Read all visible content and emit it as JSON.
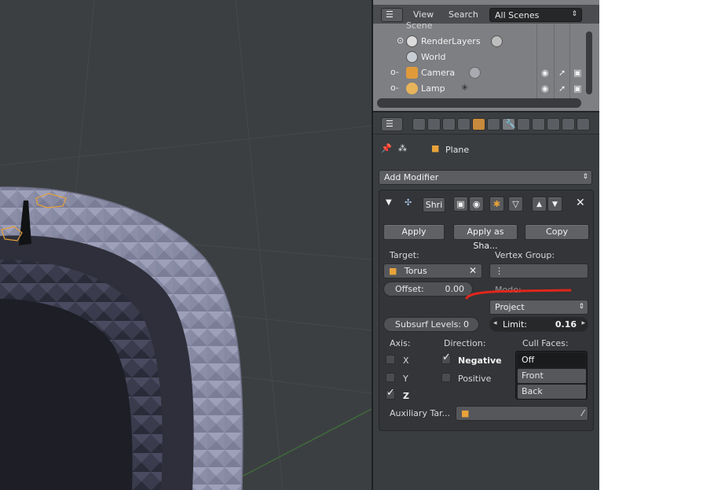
{
  "outliner": {
    "menu_view": "View",
    "menu_search": "Search",
    "scene_select": "All Scenes",
    "items": [
      {
        "label": "Scene"
      },
      {
        "label": "RenderLayers"
      },
      {
        "label": "World"
      },
      {
        "label": "Camera"
      },
      {
        "label": "Lamp"
      }
    ]
  },
  "properties": {
    "context_object": "Plane",
    "add_modifier": "Add Modifier",
    "modifier": {
      "name": "Shri",
      "apply_label": "Apply",
      "apply_shape_label": "Apply as Sha...",
      "copy_label": "Copy",
      "target_label": "Target:",
      "target_value": "Torus",
      "vertex_group_label": "Vertex Group:",
      "offset_label": "Offset:",
      "offset_value": "0.00",
      "mode_label": "Mode:",
      "mode_value": "Project",
      "subsurf_label": "Subsurf Levels:",
      "subsurf_value": "0",
      "limit_label": "Limit:",
      "limit_value": "0.16",
      "axis_label": "Axis:",
      "axis_x": "X",
      "axis_y": "Y",
      "axis_z": "Z",
      "direction_label": "Direction:",
      "dir_negative": "Negative",
      "dir_positive": "Positive",
      "cull_label": "Cull Faces:",
      "cull_options": [
        "Off",
        "Front",
        "Back"
      ],
      "aux_label": "Auxiliary Tar..."
    }
  },
  "colors": {
    "annotation_red": "#e0261c",
    "selection_orange": "#e8a33a"
  }
}
